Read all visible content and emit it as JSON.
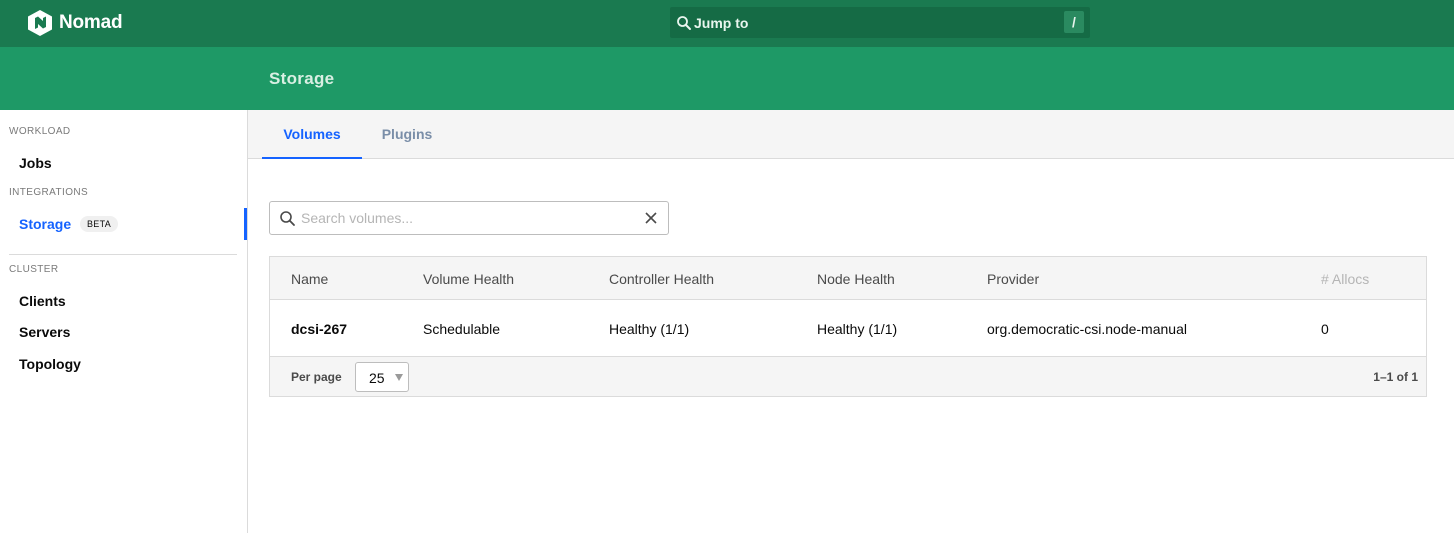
{
  "app": {
    "brand_name": "Nomad",
    "brand_icon": "nomad-logo-icon",
    "jump_to": {
      "label": "Jump to",
      "shortcut": "/"
    },
    "accent_color": "#1563ff",
    "nav_color": "#1a7a50",
    "subheader_color": "#1e9966"
  },
  "page": {
    "title": "Storage"
  },
  "sidebar": {
    "sections": [
      {
        "label": "WORKLOAD",
        "items": [
          {
            "label": "Jobs",
            "active": false
          }
        ]
      },
      {
        "label": "INTEGRATIONS",
        "items": [
          {
            "label": "Storage",
            "active": true,
            "badge": "BETA"
          }
        ]
      },
      {
        "label": "CLUSTER",
        "items": [
          {
            "label": "Clients",
            "active": false
          },
          {
            "label": "Servers",
            "active": false
          },
          {
            "label": "Topology",
            "active": false
          }
        ]
      }
    ]
  },
  "tabs": [
    {
      "label": "Volumes",
      "active": true
    },
    {
      "label": "Plugins",
      "active": false
    }
  ],
  "search": {
    "placeholder": "Search volumes...",
    "value": ""
  },
  "table": {
    "columns": [
      "Name",
      "Volume Health",
      "Controller Health",
      "Node Health",
      "Provider",
      "# Allocs"
    ],
    "rows": [
      [
        "dcsi-267",
        "Schedulable",
        "Healthy (1/1)",
        "Healthy (1/1)",
        "org.democratic-csi.node-manual",
        "0"
      ]
    ],
    "footer": {
      "per_page_label": "Per page",
      "per_page_value": "25",
      "pagination": "1–1 of 1"
    }
  }
}
